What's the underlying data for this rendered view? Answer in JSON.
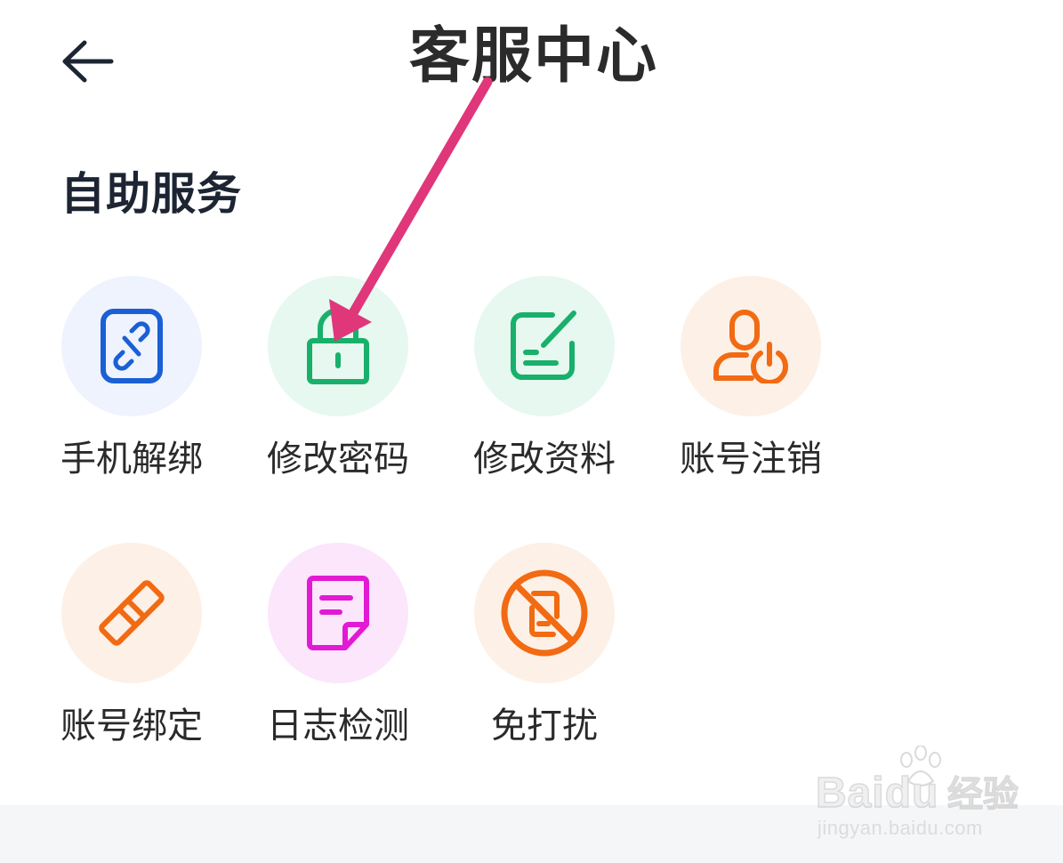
{
  "header": {
    "title": "客服中心",
    "back_icon": "back-arrow-icon"
  },
  "section": {
    "title": "自助服务"
  },
  "services": [
    {
      "label": "手机解绑",
      "icon": "phone-unbind-icon",
      "color": "#1a5fd6",
      "bg": "#eef3fd"
    },
    {
      "label": "修改密码",
      "icon": "lock-icon",
      "color": "#18b06b",
      "bg": "#e6f8f0"
    },
    {
      "label": "修改资料",
      "icon": "edit-profile-icon",
      "color": "#18b06b",
      "bg": "#e6f8f0"
    },
    {
      "label": "账号注销",
      "icon": "account-power-icon",
      "color": "#f26a12",
      "bg": "#fdf0e6"
    },
    {
      "label": "账号绑定",
      "icon": "link-icon",
      "color": "#f26a12",
      "bg": "#fdf0e6"
    },
    {
      "label": "日志检测",
      "icon": "log-document-icon",
      "color": "#e21ad4",
      "bg": "#fbe6fb"
    },
    {
      "label": "免打扰",
      "icon": "do-not-disturb-icon",
      "color": "#f26a12",
      "bg": "#fdf0e6"
    }
  ],
  "annotation": {
    "color": "#e0367a"
  },
  "watermark": {
    "brand": "Bai",
    "brand_suffix": "du",
    "brand_cn": "经验",
    "url": "jingyan.baidu.com"
  }
}
